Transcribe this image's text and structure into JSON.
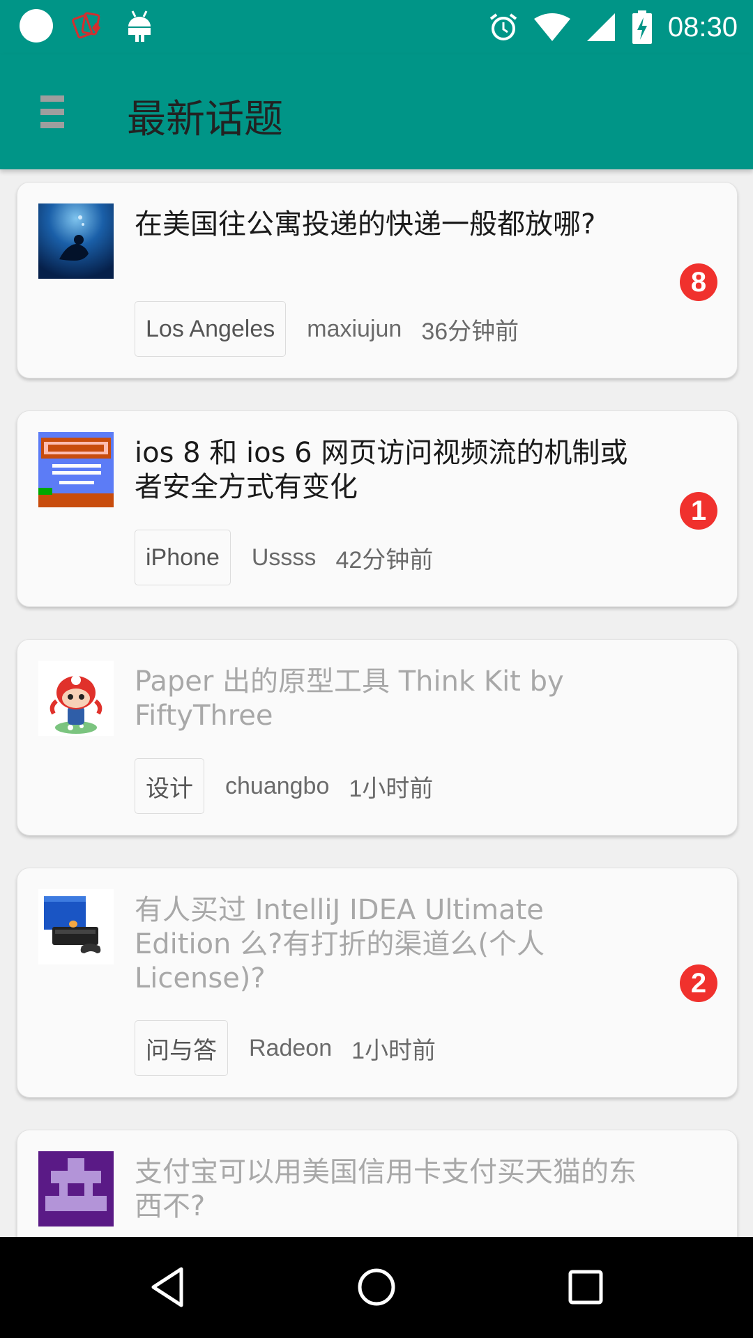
{
  "status_bar": {
    "time": "08:30",
    "icons": [
      "notification-dot-icon",
      "card-game-icon",
      "android-icon",
      "alarm-icon",
      "wifi-icon",
      "signal-icon",
      "battery-charging-icon"
    ]
  },
  "app_bar": {
    "title": "最新话题",
    "menu_icon": "menu-icon"
  },
  "topics": [
    {
      "title": "在美国往公寓投递的快递一般都放哪?",
      "node": "Los Angeles",
      "author": "maxiujun",
      "time": "36分钟前",
      "replies": "8",
      "read": false,
      "avatar": "avatar-diver"
    },
    {
      "title": "ios 8 和 ios 6 网页访问视频流的机制或者安全方式有变化",
      "node": "iPhone",
      "author": "Ussss",
      "time": "42分钟前",
      "replies": "1",
      "read": false,
      "avatar": "avatar-mario"
    },
    {
      "title": "Paper 出的原型工具 Think Kit by FiftyThree",
      "node": "设计",
      "author": "chuangbo",
      "time": "1小时前",
      "replies": "",
      "read": true,
      "avatar": "avatar-octocat"
    },
    {
      "title": "有人买过 IntelliJ IDEA Ultimate Edition 么?有打折的渠道么(个人 License)?",
      "node": "问与答",
      "author": "Radeon",
      "time": "1小时前",
      "replies": "2",
      "read": true,
      "avatar": "avatar-console"
    },
    {
      "title": "支付宝可以用美国信用卡支付买天猫的东西不?",
      "node": "",
      "author": "",
      "time": "",
      "replies": "",
      "read": true,
      "avatar": "avatar-pixel"
    }
  ],
  "nav_bar": {
    "back": "back-icon",
    "home": "home-icon",
    "recents": "recents-icon"
  },
  "colors": {
    "primary": "#009587",
    "badge": "#f0312d",
    "background": "#f0f0f0"
  }
}
